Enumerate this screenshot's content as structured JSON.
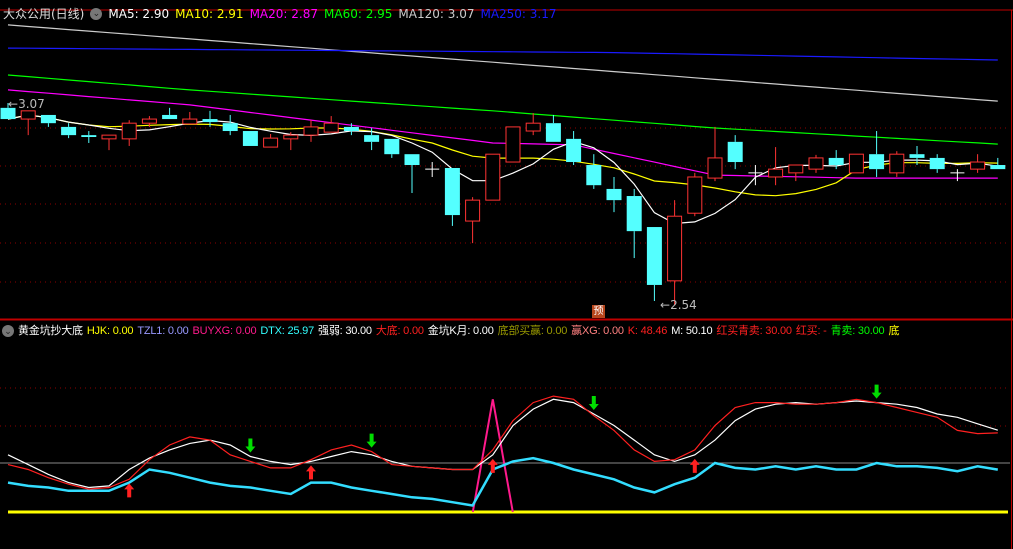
{
  "main_header": {
    "title": "大众公用(日线)",
    "ma": [
      {
        "label": "MA5: 2.90",
        "color": "#ffffff"
      },
      {
        "label": "MA10: 2.91",
        "color": "#ffff00"
      },
      {
        "label": "MA20: 2.87",
        "color": "#ff00ff"
      },
      {
        "label": "MA60: 2.95",
        "color": "#00ff00"
      },
      {
        "label": "MA120: 3.07",
        "color": "#cccccc"
      },
      {
        "label": "MA250: 3.17",
        "color": "#1a1aff"
      }
    ]
  },
  "indicator_header": {
    "title": "黄金坑抄大底",
    "items": [
      {
        "label": "HJK: 0.00",
        "color": "#ffff00"
      },
      {
        "label": "TZL1: 0.00",
        "color": "#9999ff"
      },
      {
        "label": "BUYXG: 0.00",
        "color": "#ff1a8c"
      },
      {
        "label": "DTX: 25.97",
        "color": "#33ffff"
      },
      {
        "label": "强弱: 30.00",
        "color": "#ffffff"
      },
      {
        "label": "大底: 0.00",
        "color": "#ff2020"
      },
      {
        "label": "金坑K月: 0.00",
        "color": "#ffffff"
      },
      {
        "label": "底部买赢: 0.00",
        "color": "#999900"
      },
      {
        "label": "赢XG: 0.00",
        "color": "#ff8080"
      },
      {
        "label": "K: 48.46",
        "color": "#ff2020"
      },
      {
        "label": "M: 50.10",
        "color": "#ffffff"
      },
      {
        "label": "红买青卖: 30.00",
        "color": "#ff2020"
      },
      {
        "label": "红买: -",
        "color": "#ff2020"
      },
      {
        "label": "青卖: 30.00",
        "color": "#00ff00"
      },
      {
        "label": "底",
        "color": "#ffff00"
      }
    ]
  },
  "annotations": {
    "high_label": "3.07",
    "low_label": "2.54",
    "forecast_badge": "预"
  },
  "colors": {
    "up": "#ff3333",
    "down": "#54ffff",
    "grid": "#8b0000",
    "border": "#c00000"
  },
  "candles": [
    [
      3.057,
      3.07,
      3.027,
      3.027
    ],
    [
      3.027,
      3.049,
      2.984,
      3.049
    ],
    [
      3.038,
      3.038,
      3.006,
      3.016
    ],
    [
      3.006,
      3.016,
      2.976,
      2.984
    ],
    [
      2.984,
      2.995,
      2.963,
      2.979
    ],
    [
      2.974,
      2.984,
      2.944,
      2.984
    ],
    [
      2.974,
      3.024,
      2.955,
      3.016
    ],
    [
      3.016,
      3.035,
      3.006,
      3.027
    ],
    [
      3.038,
      3.057,
      3.027,
      3.027
    ],
    [
      3.014,
      3.046,
      3.014,
      3.027
    ],
    [
      3.027,
      3.049,
      3.006,
      3.019
    ],
    [
      3.016,
      3.038,
      2.984,
      2.995
    ],
    [
      2.995,
      2.995,
      2.955,
      2.955
    ],
    [
      2.952,
      2.987,
      2.952,
      2.976
    ],
    [
      2.974,
      2.992,
      2.944,
      2.984
    ],
    [
      2.984,
      3.024,
      2.966,
      3.006
    ],
    [
      2.992,
      3.035,
      2.992,
      3.016
    ],
    [
      3.006,
      3.016,
      2.984,
      2.995
    ],
    [
      2.984,
      3.003,
      2.944,
      2.966
    ],
    [
      2.974,
      2.974,
      2.923,
      2.933
    ],
    [
      2.933,
      2.933,
      2.829,
      2.904
    ],
    [
      2.893,
      2.912,
      2.872,
      2.893
    ],
    [
      2.896,
      2.896,
      2.741,
      2.77
    ],
    [
      2.754,
      2.818,
      2.695,
      2.81
    ],
    [
      2.81,
      2.933,
      2.81,
      2.933
    ],
    [
      2.912,
      3.006,
      2.912,
      3.006
    ],
    [
      2.995,
      3.043,
      2.984,
      3.016
    ],
    [
      3.016,
      3.038,
      2.966,
      2.966
    ],
    [
      2.974,
      2.995,
      2.904,
      2.912
    ],
    [
      2.904,
      2.933,
      2.84,
      2.85
    ],
    [
      2.84,
      2.872,
      2.778,
      2.81
    ],
    [
      2.821,
      2.84,
      2.655,
      2.727
    ],
    [
      2.738,
      2.738,
      2.54,
      2.583
    ],
    [
      2.594,
      2.81,
      2.529,
      2.767
    ],
    [
      2.775,
      2.883,
      2.767,
      2.872
    ],
    [
      2.869,
      3.006,
      2.861,
      2.923
    ],
    [
      2.966,
      2.984,
      2.893,
      2.912
    ],
    [
      2.883,
      2.904,
      2.85,
      2.883
    ],
    [
      2.872,
      2.952,
      2.85,
      2.893
    ],
    [
      2.883,
      2.904,
      2.861,
      2.904
    ],
    [
      2.893,
      2.931,
      2.883,
      2.923
    ],
    [
      2.923,
      2.944,
      2.893,
      2.904
    ],
    [
      2.883,
      2.933,
      2.883,
      2.933
    ],
    [
      2.933,
      2.995,
      2.872,
      2.893
    ],
    [
      2.883,
      2.941,
      2.872,
      2.933
    ],
    [
      2.933,
      2.955,
      2.904,
      2.923
    ],
    [
      2.923,
      2.933,
      2.883,
      2.893
    ],
    [
      2.883,
      2.893,
      2.861,
      2.883
    ],
    [
      2.893,
      2.933,
      2.883,
      2.912
    ],
    [
      2.904,
      2.923,
      2.893,
      2.893
    ]
  ],
  "ma_long": {
    "MA20": {
      "color": "#ff00ff",
      "points": [
        [
          0,
          3.105
        ],
        [
          9,
          3.065
        ],
        [
          24,
          2.963
        ],
        [
          28,
          2.958
        ],
        [
          35,
          2.877
        ],
        [
          42,
          2.869
        ],
        [
          49,
          2.869
        ]
      ]
    },
    "MA60": {
      "color": "#00ff00",
      "points": [
        [
          0,
          3.145
        ],
        [
          9,
          3.105
        ],
        [
          24,
          3.049
        ],
        [
          35,
          3.003
        ],
        [
          49,
          2.96
        ]
      ]
    },
    "MA120": {
      "color": "#cccccc",
      "points": [
        [
          0,
          3.279
        ],
        [
          49,
          3.075
        ]
      ]
    },
    "MA250": {
      "color": "#1a1aff",
      "points": [
        [
          0,
          3.217
        ],
        [
          30,
          3.205
        ],
        [
          49,
          3.185
        ]
      ]
    }
  },
  "indicator": {
    "M": [
      35,
      29,
      23,
      18,
      15,
      16,
      26,
      33,
      38,
      42,
      44,
      41,
      34,
      31,
      29,
      31,
      34,
      37,
      35,
      31,
      28,
      27,
      26,
      26,
      35,
      53,
      63,
      69,
      67,
      60,
      53,
      44,
      35,
      31,
      35,
      44,
      56,
      63,
      66,
      67,
      66,
      67,
      68,
      67,
      66,
      64,
      60,
      58,
      54,
      50.1
    ],
    "K": [
      29,
      26,
      21,
      17,
      14,
      15,
      20,
      32,
      41,
      46,
      44,
      35,
      31,
      27,
      27,
      32,
      38,
      41,
      37,
      29,
      28,
      27,
      26,
      26,
      38,
      56,
      67,
      71,
      69,
      59,
      50,
      38,
      31,
      32,
      38,
      53,
      64,
      67,
      67,
      66,
      66,
      67,
      69,
      67,
      64,
      61,
      58,
      50,
      48,
      48.46
    ],
    "DTX": [
      18,
      16,
      15,
      13,
      13,
      13,
      18,
      26,
      24,
      21,
      18,
      16,
      15,
      13,
      11,
      18,
      18,
      15,
      13,
      11,
      9,
      8,
      6,
      4,
      26,
      31,
      33,
      30,
      26,
      23,
      20,
      15,
      12,
      17,
      21,
      30,
      27,
      26,
      28,
      26,
      28,
      26,
      26,
      30,
      28,
      28,
      27,
      25,
      28,
      25.97
    ],
    "strength_level": 30,
    "spike": {
      "index": 24,
      "value": 69
    },
    "buy_arrows": [
      6,
      15,
      24,
      34
    ],
    "sell_arrows": [
      12,
      18,
      29,
      43
    ]
  }
}
